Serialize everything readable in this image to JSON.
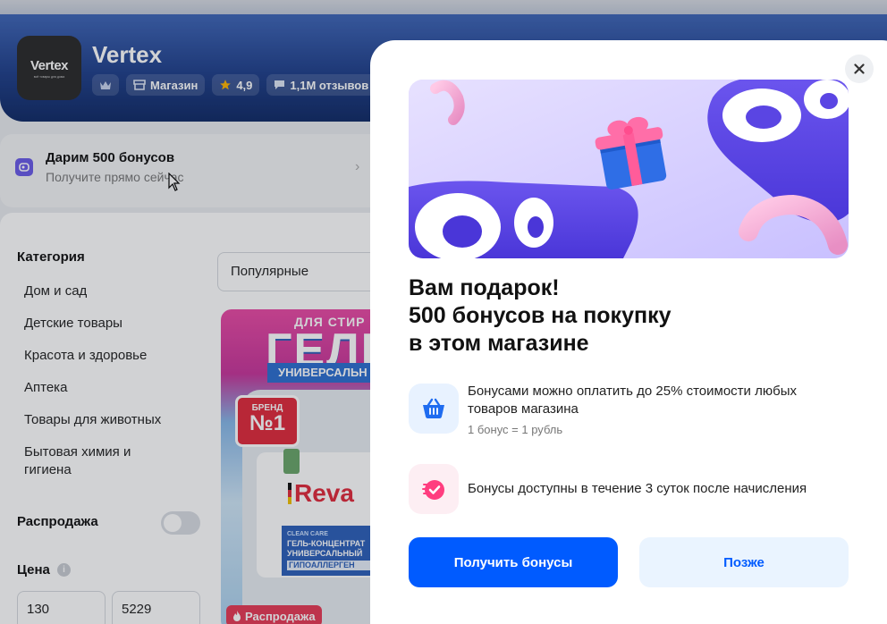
{
  "shop": {
    "logo_text": "Vertex",
    "logo_sub": "всё товары для дома",
    "name": "Vertex",
    "type_label": "Магазин",
    "rating": "4,9",
    "reviews": "1,1М отзывов"
  },
  "promo": {
    "title": "Дарим 500 бонусов",
    "subtitle": "Получите прямо сейчас"
  },
  "filters": {
    "category_title": "Категория",
    "categories": [
      "Дом и сад",
      "Детские товары",
      "Красота и здоровье",
      "Аптека",
      "Товары для животных",
      "Бытовая химия и гигиена"
    ],
    "sale_label": "Распродажа",
    "sale_enabled": false,
    "price_title": "Цена",
    "price_from": "130",
    "price_to": "5229"
  },
  "sort": {
    "value": "Популярные"
  },
  "product": {
    "top_text": "ДЛЯ СТИР",
    "big_text": "ГЕЛЬ",
    "band_text": "УНИВЕРСАЛЬН",
    "brand_badge_top": "БРЕНД",
    "brand_badge_main": "№1",
    "brand_name": "Reva",
    "clean_care": "CLEAN CARE",
    "panel_line1": "ГЕЛЬ-КОНЦЕНТРАТ",
    "panel_line2": "УНИВЕРСАЛЬНЫЙ",
    "panel_line3": "ГИПОАЛЛЕРГЕН",
    "sale_tag": "Распродажа"
  },
  "modal": {
    "title_lines": [
      "Вам подарок!",
      "500 бонусов на покупку",
      "в этом магазине"
    ],
    "features": [
      {
        "icon": "basket-icon",
        "text_line1": "Бонусами можно оплатить до 25% стоимости любых",
        "text_line2": "товаров магазина",
        "sub": "1 бонус = 1 рубль"
      },
      {
        "icon": "timer-check-icon",
        "text_line1": "Бонусы доступны в течение 3 суток после начисления"
      }
    ],
    "primary_button": "Получить бонусы",
    "secondary_button": "Позже"
  },
  "colors": {
    "accent": "#005bff",
    "secondary_bg": "#eaf4ff",
    "header_blue": "#1f3f8a",
    "sale_red": "#e73a55"
  }
}
